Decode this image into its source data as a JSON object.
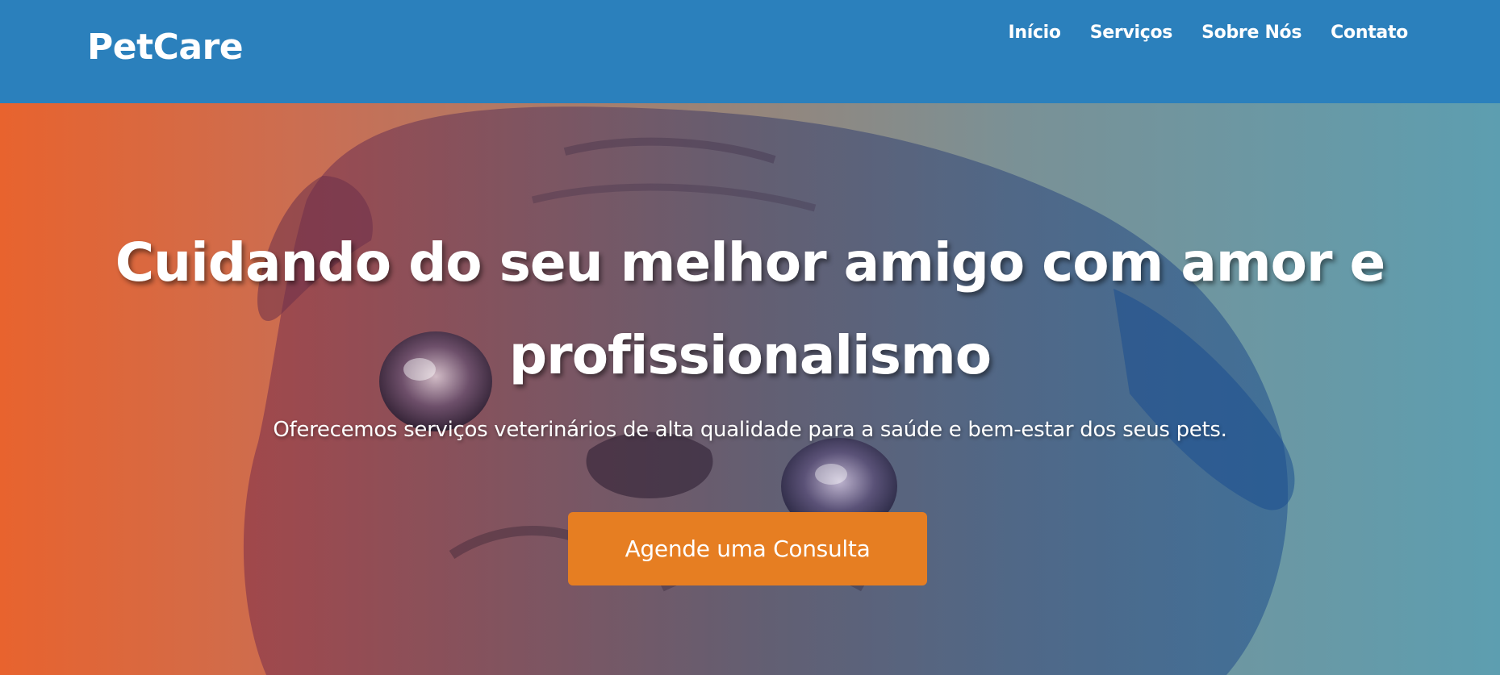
{
  "header": {
    "logo": "PetCare",
    "nav": [
      {
        "label": "Início"
      },
      {
        "label": "Serviços"
      },
      {
        "label": "Sobre Nós"
      },
      {
        "label": "Contato"
      }
    ]
  },
  "hero": {
    "title": "Cuidando do seu melhor amigo com amor e profissionalismo",
    "subtitle": "Oferecemos serviços veterinários de alta qualidade para a saúde e bem-estar dos seus pets.",
    "cta_label": "Agende uma Consulta",
    "background_image": "pug-dog-photo"
  },
  "colors": {
    "header_bg": "#2b80bc",
    "gradient_left": "#e8632e",
    "gradient_right": "#5d9eb0",
    "cta_bg": "#e67e22",
    "text": "#ffffff"
  }
}
